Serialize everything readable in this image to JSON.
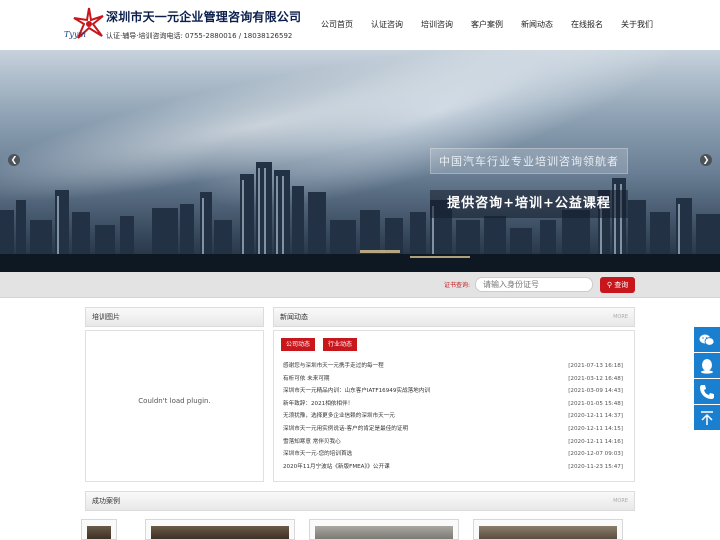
{
  "header": {
    "logo_mark": "Tyym",
    "company_name": "深圳市天一元企业管理咨询有限公司",
    "tagline": "认证·辅导·培训咨询电话: 0755-2880016 / 18038126592"
  },
  "nav": {
    "items": [
      "公司首页",
      "认证咨询",
      "培训咨询",
      "客户案例",
      "新闻动态",
      "在线报名",
      "关于我们"
    ]
  },
  "banner": {
    "slogan_line1": "中国汽车行业专业培训咨询领航者",
    "slogan_line2": "提供咨询+培训+公益课程",
    "prev_icon": "arrow-left-icon",
    "next_icon": "arrow-right-icon"
  },
  "cert_search": {
    "label": "证书查询:",
    "placeholder": "请输入身份证号",
    "button": "查询"
  },
  "training_photos": {
    "title": "培训图片",
    "plugin_message": "Couldn't load plugin."
  },
  "news": {
    "title": "新闻动态",
    "more": "MORE",
    "tabs": [
      "公司动态",
      "行业动态"
    ],
    "items": [
      {
        "title": "感谢您与深圳市天一元携手走过的每一程",
        "date": "[2021-07-13 16:18]"
      },
      {
        "title": "有析可依 未来可期",
        "date": "[2021-03-12 16:48]"
      },
      {
        "title": "深圳市天一元精品内训：山东客户IATF16949实战落地内训",
        "date": "[2021-03-09 14:43]"
      },
      {
        "title": "新年致辞：2021相依相伴！",
        "date": "[2021-01-05 15:48]"
      },
      {
        "title": "无须犹豫，选择更多企业信赖的深圳市天一元",
        "date": "[2020-12-11 14:37]"
      },
      {
        "title": "深圳市天一元用实例说话-客户的肯定是最佳的证明",
        "date": "[2020-12-11 14:15]"
      },
      {
        "title": "雪落知寒意 常伴贝我心",
        "date": "[2020-12-11 14:16]"
      },
      {
        "title": "深圳市天一元-您的培训首选",
        "date": "[2020-12-07 09:03]"
      },
      {
        "title": "2020年11月宁波站《新版FMEA》》公开课",
        "date": "[2020-11-23 15:47]"
      }
    ]
  },
  "cases": {
    "title": "成功案例",
    "more": "MORE"
  },
  "side_toolbar": {
    "icons": [
      "wechat-icon",
      "qq-icon",
      "phone-icon",
      "back-to-top-icon"
    ]
  },
  "colors": {
    "accent": "#c8161d",
    "side_blue": "#1b7fd0"
  }
}
